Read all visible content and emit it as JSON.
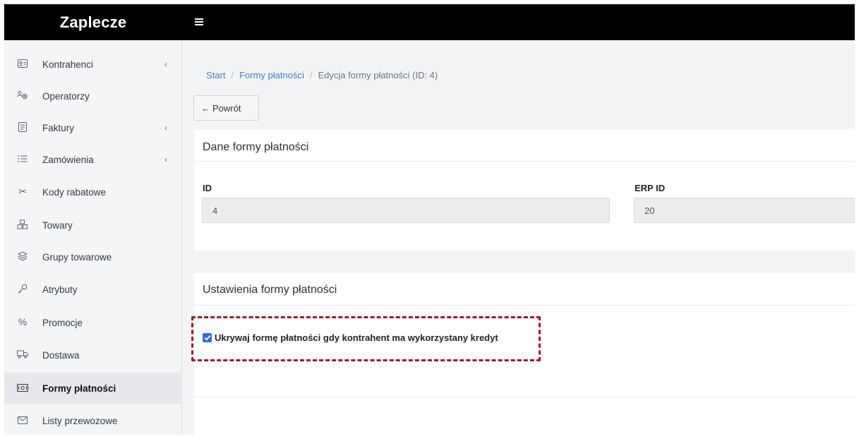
{
  "app": {
    "brand": "Zaplecze"
  },
  "sidebar": {
    "items": [
      {
        "label": "Kontrahenci",
        "icon": "contact-card-icon",
        "expandable": true
      },
      {
        "label": "Operatorzy",
        "icon": "users-gear-icon",
        "expandable": false
      },
      {
        "label": "Faktury",
        "icon": "invoice-icon",
        "expandable": true
      },
      {
        "label": "Zamówienia",
        "icon": "list-icon",
        "expandable": true
      },
      {
        "label": "Kody rabatowe",
        "icon": "scissors-icon",
        "expandable": false
      },
      {
        "label": "Towary",
        "icon": "boxes-icon",
        "expandable": false
      },
      {
        "label": "Grupy towarowe",
        "icon": "layers-icon",
        "expandable": false
      },
      {
        "label": "Atrybuty",
        "icon": "key-icon",
        "expandable": false
      },
      {
        "label": "Promocje",
        "icon": "percent-icon",
        "expandable": false
      },
      {
        "label": "Dostawa",
        "icon": "truck-icon",
        "expandable": false
      },
      {
        "label": "Formy płatności",
        "icon": "money-icon",
        "expandable": false,
        "active": true
      },
      {
        "label": "Listy przewozowe",
        "icon": "envelope-icon",
        "expandable": false
      }
    ]
  },
  "breadcrumb": {
    "start": "Start",
    "payment_forms": "Formy płatności",
    "current": "Edycja formy płatności (ID: 4)",
    "separator": "/"
  },
  "back_button": {
    "label": "Powrót"
  },
  "details_card": {
    "title": "Dane formy płatności",
    "id_label": "ID",
    "id_value": "4",
    "erp_label": "ERP ID",
    "erp_value": "20"
  },
  "settings_card": {
    "title": "Ustawienia formy płatności",
    "hide_when_credit_used_label": "Ukrywaj formę płatności gdy kontrahent ma wykorzystany kredyt",
    "hide_when_credit_used_checked": true
  },
  "colors": {
    "topbar": "#000000",
    "accent": "#2f6fd6",
    "link": "#3b82c4",
    "highlight_border": "#a3182f"
  }
}
